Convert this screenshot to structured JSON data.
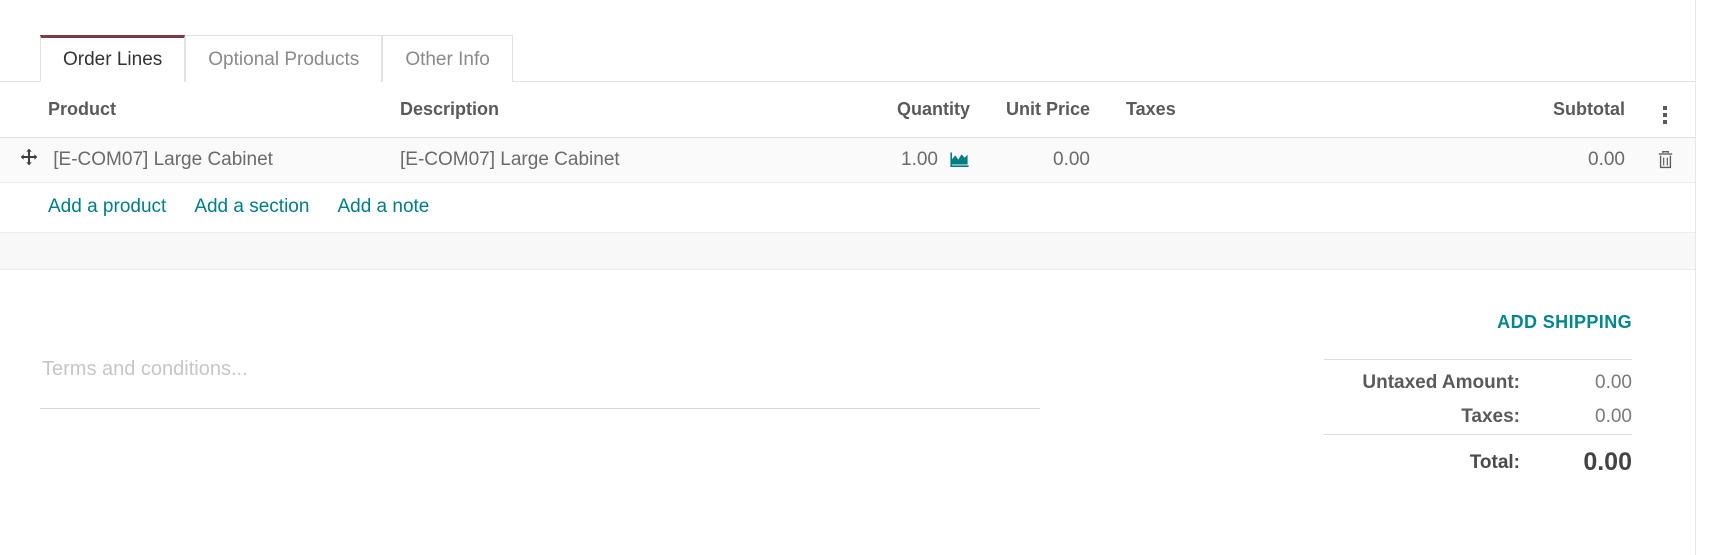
{
  "tabs": [
    {
      "label": "Order Lines",
      "active": true
    },
    {
      "label": "Optional Products",
      "active": false
    },
    {
      "label": "Other Info",
      "active": false
    }
  ],
  "table": {
    "columns": {
      "product": "Product",
      "description": "Description",
      "quantity": "Quantity",
      "unit_price": "Unit Price",
      "taxes": "Taxes",
      "subtotal": "Subtotal"
    },
    "rows": [
      {
        "product": "[E-COM07] Large Cabinet",
        "description": "[E-COM07] Large Cabinet",
        "quantity": "1.00",
        "unit_price": "0.00",
        "taxes": "",
        "subtotal": "0.00"
      }
    ],
    "options_icon": "kebab-menu-icon",
    "row_drag_icon": "drag-move-icon",
    "row_forecast_icon": "area-chart-icon",
    "row_delete_icon": "trash-icon"
  },
  "add_links": [
    {
      "label": "Add a product"
    },
    {
      "label": "Add a section"
    },
    {
      "label": "Add a note"
    }
  ],
  "terms": {
    "placeholder": "Terms and conditions...",
    "value": ""
  },
  "totals": {
    "add_shipping_label": "ADD SHIPPING",
    "untaxed_label": "Untaxed Amount:",
    "untaxed_value": "0.00",
    "taxes_label": "Taxes:",
    "taxes_value": "0.00",
    "total_label": "Total:",
    "total_value": "0.00"
  },
  "colors": {
    "accent_teal": "#017e84",
    "accent_teal_bright": "#00878a",
    "active_tab_border": "#7d3c45",
    "text_muted": "#8a8a8a",
    "row_bg": "#fafafa"
  }
}
